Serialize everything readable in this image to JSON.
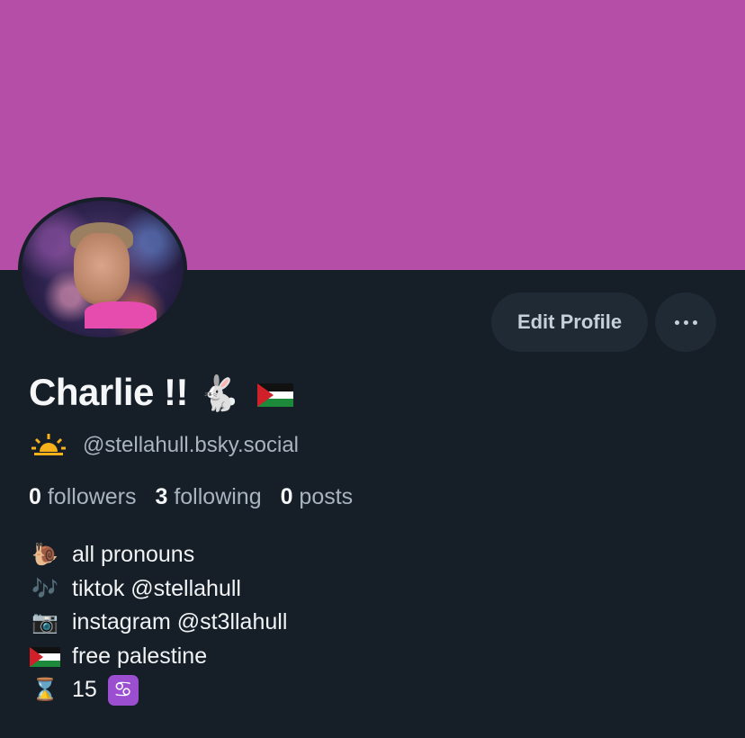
{
  "profile": {
    "display_name": "Charlie !!",
    "name_emoji": "🐇",
    "handle": "@stellahull.bsky.social",
    "banner_color": "#b54ea6",
    "background_color": "#161e27"
  },
  "actions": {
    "edit_profile_label": "Edit Profile",
    "more_icon": "ellipsis-icon"
  },
  "stats": {
    "followers_count": "0",
    "followers_label": "followers",
    "following_count": "3",
    "following_label": "following",
    "posts_count": "0",
    "posts_label": "posts"
  },
  "bio": {
    "lines": [
      {
        "emoji": "🐌",
        "text": "all pronouns"
      },
      {
        "emoji": "🎶",
        "text": "tiktok @stellahull"
      },
      {
        "emoji": "📷",
        "text": "instagram @st3llahull"
      },
      {
        "emoji": "palestine-flag",
        "text": "free palestine"
      },
      {
        "emoji": "⌛",
        "text": "15",
        "trailing_emoji": "♋"
      }
    ]
  }
}
